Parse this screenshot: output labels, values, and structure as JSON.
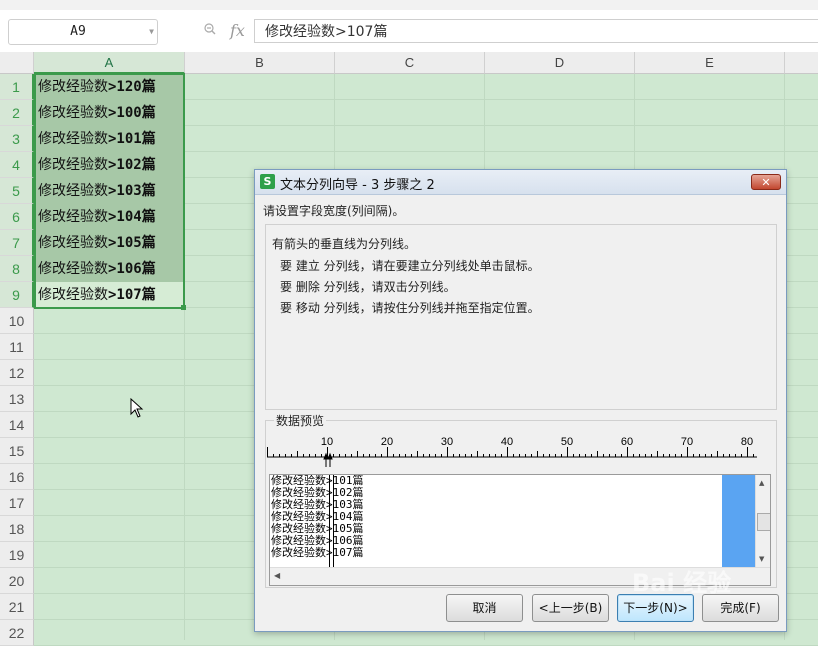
{
  "formula_bar": {
    "name_box": "A9",
    "fx_label": "fx",
    "formula": "修改经验数>107篇"
  },
  "sheet": {
    "columns": [
      "A",
      "B",
      "C",
      "D",
      "E"
    ],
    "rows": [
      "1",
      "2",
      "3",
      "4",
      "5",
      "6",
      "7",
      "8",
      "9",
      "10",
      "11",
      "12",
      "13",
      "14",
      "15",
      "16",
      "17",
      "18",
      "19",
      "20",
      "21",
      "22"
    ],
    "cells_prefix": "修改经验数",
    "cells_suffix": [
      ">120篇",
      ">100篇",
      ">101篇",
      ">102篇",
      ">103篇",
      ">104篇",
      ">105篇",
      ">106篇",
      ">107篇"
    ],
    "selected_column": "A",
    "active_cell_row": 9
  },
  "dialog": {
    "app_icon": "S",
    "title": "文本分列向导 - 3 步骤之 2",
    "close_label": "✕",
    "prompt": "请设置字段宽度(列间隔)。",
    "info": {
      "heading": "有箭头的垂直线为分列线。",
      "line1": "要 建立 分列线，请在要建立分列线处单击鼠标。",
      "line2": "要 删除 分列线，请双击分列线。",
      "line3": "要 移动 分列线，请按住分列线并拖至指定位置。"
    },
    "preview_label": "数据预览",
    "ruler_ticks": [
      "10",
      "20",
      "30",
      "40",
      "50",
      "60",
      "70",
      "80"
    ],
    "preview_lines": [
      "修改经验数>101篇",
      "修改经验数>102篇",
      "修改经验数>103篇",
      "修改经验数>104篇",
      "修改经验数>105篇",
      "修改经验数>106篇",
      "修改经验数>107篇"
    ],
    "buttons": {
      "cancel": "取消",
      "back": "<上一步(B)",
      "next": "下一步(N)>",
      "finish": "完成(F)"
    }
  },
  "watermark": "Bai 经验",
  "colors": {
    "sheet_bg": "#cfe8d1",
    "selection": "#3b9a4b",
    "selected_cells": "#a7c8a7",
    "preview_highlight": "#5aa4f2"
  }
}
